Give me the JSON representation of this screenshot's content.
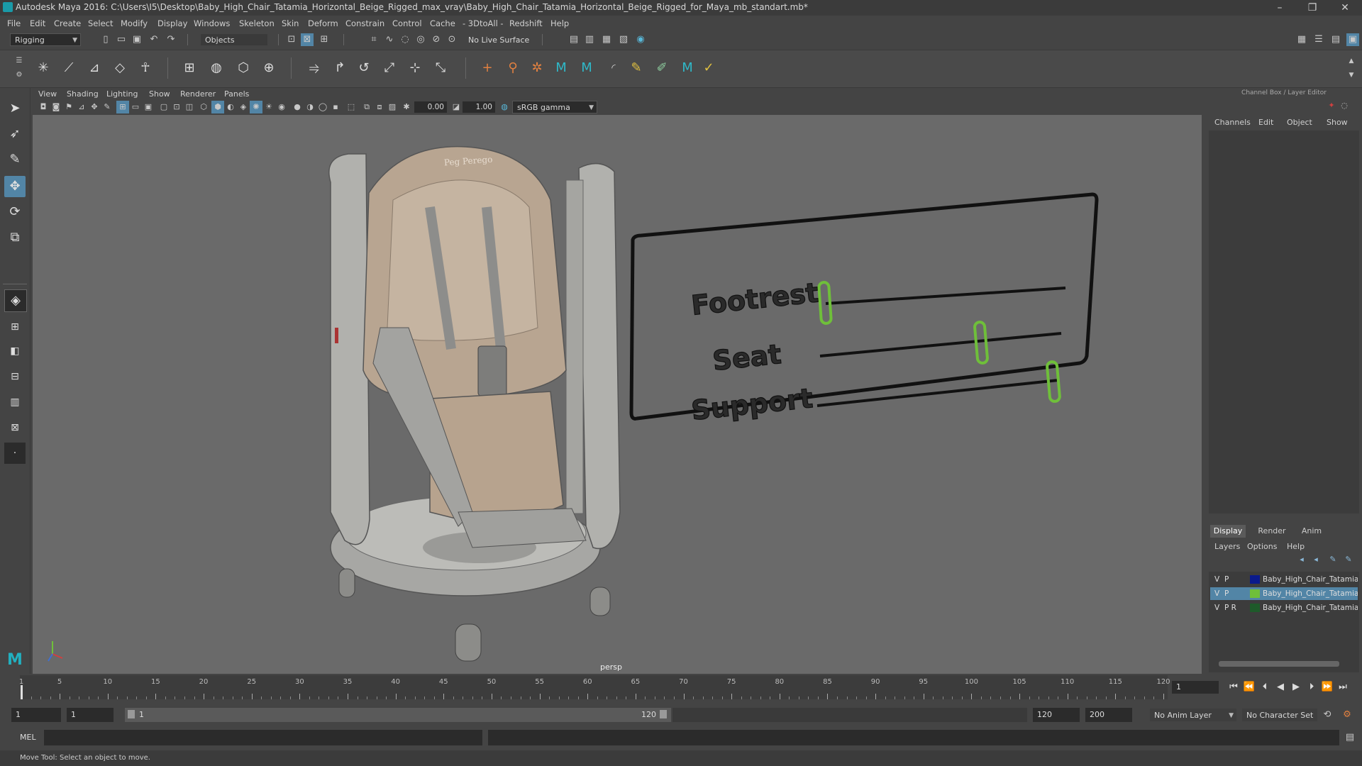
{
  "window": {
    "title": "Autodesk Maya 2016: C:\\Users\\I5\\Desktop\\Baby_High_Chair_Tatamia_Horizontal_Beige_Rigged_max_vray\\Baby_High_Chair_Tatamia_Horizontal_Beige_Rigged_for_Maya_mb_standart.mb*",
    "minimize": "–",
    "restore": "❐",
    "close": "✕"
  },
  "menubar": [
    "File",
    "Edit",
    "Create",
    "Select",
    "Modify",
    "Display",
    "Windows",
    "Skeleton",
    "Skin",
    "Deform",
    "Constrain",
    "Control",
    "Cache",
    "- 3DtoAll -",
    "Redshift",
    "Help"
  ],
  "statusline": {
    "mode": "Rigging",
    "selection_mode": "Objects",
    "live_surface": "No Live Surface"
  },
  "panel": {
    "menu": [
      "View",
      "Shading",
      "Lighting",
      "Show",
      "Renderer",
      "Panels"
    ],
    "exposure": "0.00",
    "gamma": "1.00",
    "color_space": "sRGB gamma",
    "camera": "persp"
  },
  "rig_control": {
    "labels": [
      "Footrest",
      "Seat",
      "Support"
    ]
  },
  "chair": {
    "brand": "Peg Perego"
  },
  "channelbox": {
    "header": "Channel Box / Layer Editor",
    "menu": [
      "Channels",
      "Edit",
      "Object",
      "Show"
    ],
    "tabs": [
      "Display",
      "Render",
      "Anim"
    ],
    "layer_menu": [
      "Layers",
      "Options",
      "Help"
    ],
    "layers": [
      {
        "v": "V",
        "p": "P",
        "name": "Baby_High_Chair_Tatamia_Horizontal_Beige",
        "color": "#0a1a8c",
        "selected": false
      },
      {
        "v": "V",
        "p": "P",
        "name": "Baby_High_Chair_Tatamia_Horizontal_Beige_Controllers",
        "color": "#6fbf3a",
        "selected": true
      },
      {
        "v": "V",
        "p": "P R",
        "name": "Baby_High_Chair_Tatamia_Horizontal_Beige_Helpers",
        "color": "#1e5a2a",
        "selected": false
      }
    ]
  },
  "timeline": {
    "labels": [
      "1",
      "5",
      "10",
      "15",
      "20",
      "25",
      "30",
      "35",
      "40",
      "45",
      "50",
      "55",
      "60",
      "65",
      "70",
      "75",
      "80",
      "85",
      "90",
      "95",
      "100",
      "105",
      "110",
      "115",
      "120"
    ],
    "current_frame": "1"
  },
  "range": {
    "start": "1",
    "playback_start": "1",
    "range_start_label": "1",
    "range_end_label": "120",
    "playback_end": "120",
    "end": "200",
    "anim_layer": "No Anim Layer",
    "character_set": "No Character Set"
  },
  "command": {
    "language": "MEL"
  },
  "help": "Move Tool: Select an object to move."
}
